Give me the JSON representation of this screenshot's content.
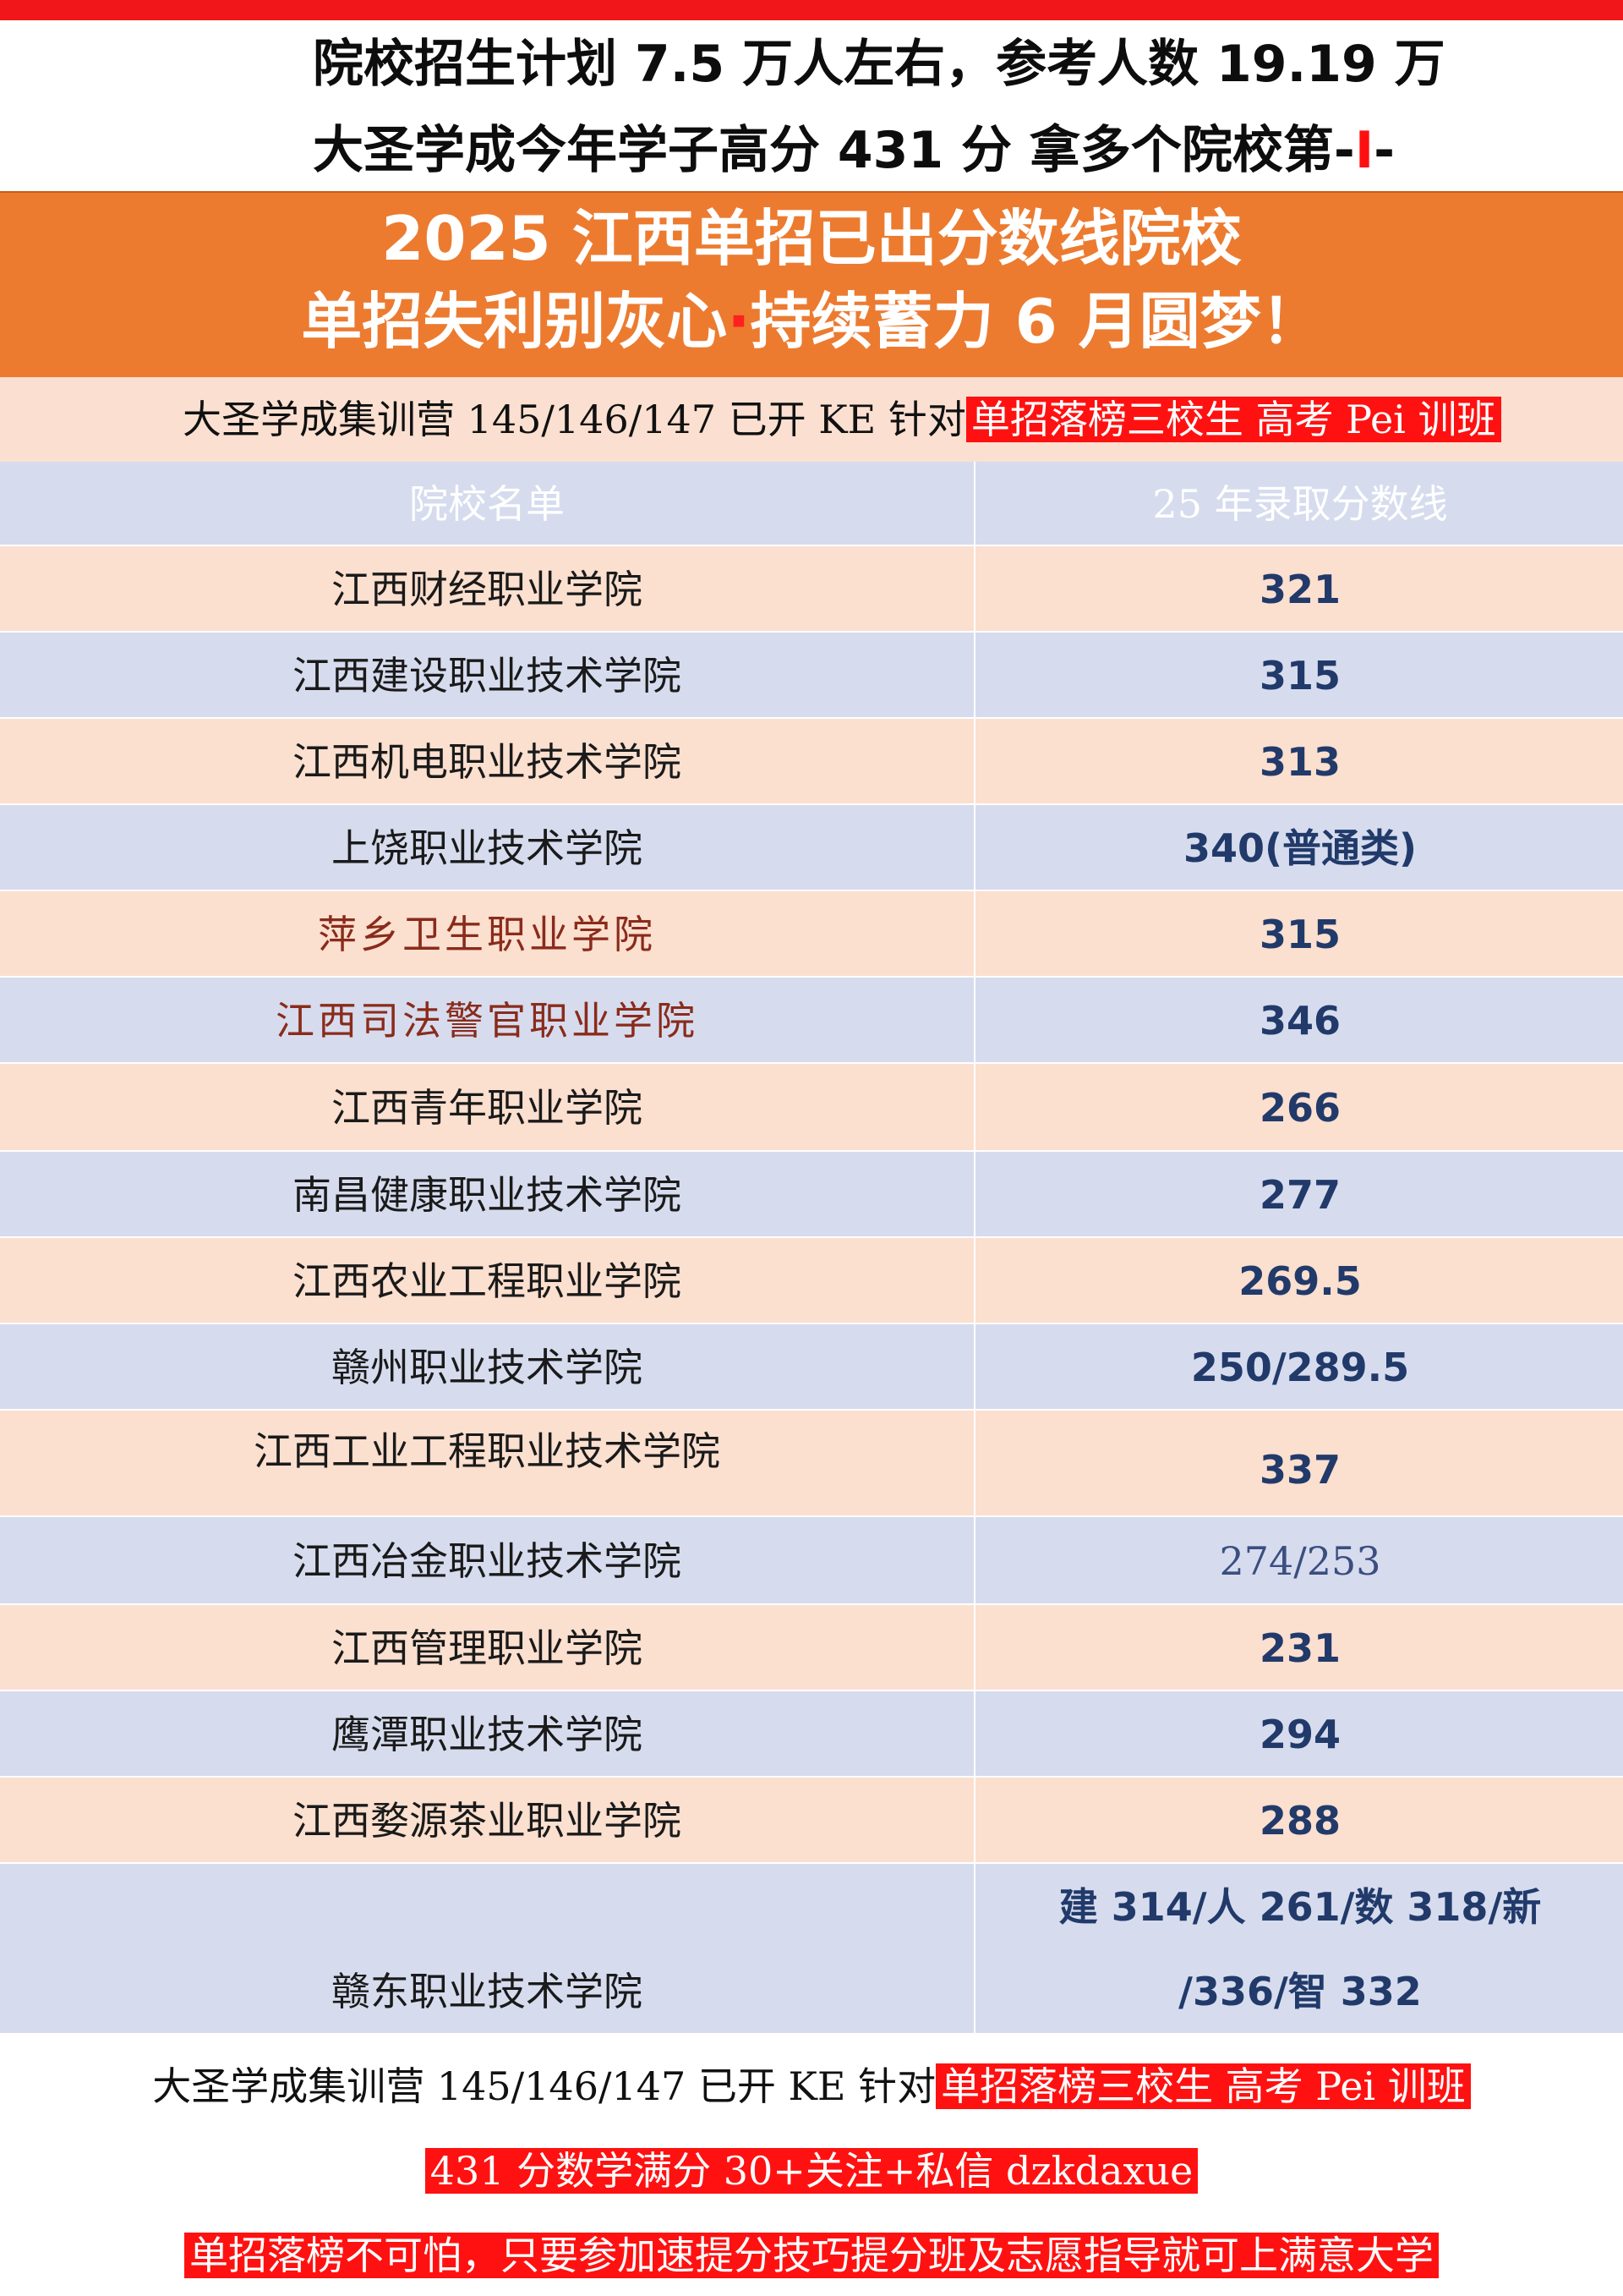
{
  "header": {
    "line1": "院校招生计划 7.5 万人左右，参考人数 19.19 万",
    "line2_prefix": "大圣学成今年学子高分 431 分 拿多个院校第-",
    "line2_mark": "I",
    "line2_suffix": "-"
  },
  "banner": {
    "line1": "2025 江西单招已出分数线院校",
    "line2_a": "单招失利别灰心",
    "line2_dot": "·",
    "line2_b": "持续蓄力 6 月圆梦！"
  },
  "promo": {
    "text": "大圣学成集训营 145/146/147 已开 KE 针对",
    "highlight": "单招落榜三校生 高考 Pei 训班"
  },
  "table": {
    "header_name": "院校名单",
    "header_score": "25 年录取分数线",
    "rows": [
      {
        "name": "江西财经职业学院",
        "score": "321"
      },
      {
        "name": "江西建设职业技术学院",
        "score": "315"
      },
      {
        "name": "江西机电职业技术学院",
        "score": "313"
      },
      {
        "name": "上饶职业技术学院",
        "score": "340(普通类)"
      },
      {
        "name": "萍乡卫生职业学院",
        "score": "315"
      },
      {
        "name": "江西司法警官职业学院",
        "score": "346"
      },
      {
        "name": "江西青年职业学院",
        "score": "266"
      },
      {
        "name": "南昌健康职业技术学院",
        "score": "277"
      },
      {
        "name": "江西农业工程职业学院",
        "score": "269.5"
      },
      {
        "name": "赣州职业技术学院",
        "score": "250/289.5"
      },
      {
        "name": "江西工业工程职业技术学院",
        "score": "337"
      },
      {
        "name": "江西冶金职业技术学院",
        "score": "274/253"
      },
      {
        "name": "江西管理职业学院",
        "score": "231"
      },
      {
        "name": "鹰潭职业技术学院",
        "score": "294"
      },
      {
        "name": "江西婺源茶业职业学院",
        "score": "288"
      },
      {
        "name": "赣东职业技术学院",
        "score_line1": "建 314/人 261/数 318/新",
        "score_line2": "/336/智 332"
      }
    ]
  },
  "footer": {
    "line1_text": "大圣学成集训营 145/146/147 已开 KE 针对",
    "line1_highlight": "单招落榜三校生 高考 Pei 训班",
    "line2": "431 分数学满分 30+关注+私信 dzkdaxue",
    "line3": "单招落榜不可怕，只要参加速提分技巧提分班及志愿指导就可上满意大学"
  },
  "colors": {
    "top_bar": "#f0161a",
    "banner_orange": "#ec7b30",
    "row_peach": "#fbdfcf",
    "row_blue": "#d6dcee",
    "highlight_red": "#ff1111",
    "score_navy": "#213a6a",
    "name_darkred": "#8a2b1b"
  }
}
